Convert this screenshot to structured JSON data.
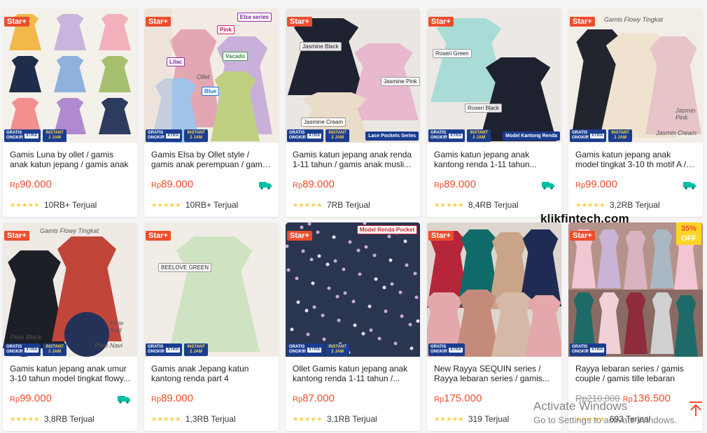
{
  "products": [
    {
      "title": "Gamis Luna by ollet / gamis anak katun jepang / gamis anak",
      "price": "90.000",
      "old_price": "",
      "sold": "10RB+ Terjual",
      "badge": "Star+",
      "free_shipping_icon": false,
      "discount": "",
      "strip_extra": "",
      "stickers": [],
      "art": {
        "bg": "#f4f1ea",
        "swatches": [
          "#f2b94a",
          "#c9b4de",
          "#f2b1bb",
          "#1f2d4a",
          "#8fb1dd",
          "#a6c070",
          "#f28f8f",
          "#b08ad0",
          "#2c3b5e"
        ]
      }
    },
    {
      "title": "Gamis Elsa by Ollet style / gamis anak perempuan / gamis anak",
      "price": "89.000",
      "old_price": "",
      "sold": "10RB+ Terjual",
      "badge": "Star+",
      "free_shipping_icon": true,
      "discount": "",
      "strip_extra": "",
      "stickers": [
        {
          "text": "Elza series",
          "cls": "tag-purple",
          "pos": "right:10px;top:6px;"
        },
        {
          "text": "Pink",
          "cls": "tag-pink",
          "pos": "left:104px;top:24px;"
        },
        {
          "text": "Lilac",
          "cls": "tag-purple",
          "pos": "left:32px;top:70px;"
        },
        {
          "text": "Vacado",
          "cls": "tag-green",
          "pos": "left:112px;top:62px;"
        },
        {
          "text": "Blue",
          "cls": "tag-blue",
          "pos": "left:82px;top:112px;"
        },
        {
          "text": "Ollet",
          "cls": "hand",
          "pos": "left:72px;top:92px;"
        }
      ],
      "art": {
        "bg": "#f2ece4",
        "swatches": [
          "#e3a7b3",
          "#c9b0da",
          "#bfd181",
          "#9fc3e9",
          "#c98da0",
          "#dcd8d0"
        ]
      }
    },
    {
      "title": "Gamis katun jepang anak renda 1-11 tahun / gamis anak musli...",
      "price": "89.000",
      "old_price": "",
      "sold": "7RB Terjual",
      "badge": "Star+",
      "free_shipping_icon": false,
      "discount": "",
      "strip_extra": "Lace Pockets Series",
      "stickers": [
        {
          "text": "Jasmine Black",
          "cls": "",
          "pos": "left:20px;top:48px;"
        },
        {
          "text": "Jasmine Pink",
          "cls": "",
          "pos": "left:136px;top:98px;"
        },
        {
          "text": "Jasmine Cream",
          "cls": "",
          "pos": "left:22px;top:156px;"
        }
      ],
      "art": {
        "bg": "#eae7e2",
        "swatches": [
          "#1f2230",
          "#e8b8cf",
          "#e9dcc9"
        ]
      }
    },
    {
      "title": "Gamis katun jepang anak kantong renda 1-11 tahun...",
      "price": "89.000",
      "old_price": "",
      "sold": "8,4RB Terjual",
      "badge": "Star+",
      "free_shipping_icon": true,
      "discount": "",
      "strip_extra": "Model Kantong Renda",
      "stickers": [
        {
          "text": "Roseri Green",
          "cls": "",
          "pos": "left:8px;top:58px;"
        },
        {
          "text": "Roseri Black",
          "cls": "",
          "pos": "left:54px;top:136px;"
        }
      ],
      "art": {
        "bg": "#ece8e3",
        "swatches": [
          "#a9dcd6",
          "#1e2230"
        ]
      }
    },
    {
      "title": "Gamis katun jepang anak model tingkat 3-10 th motif A / gamis...",
      "price": "99.000",
      "old_price": "",
      "sold": "3,2RB Terjual",
      "badge": "Star+",
      "free_shipping_icon": true,
      "discount": "",
      "strip_extra": "",
      "stickers": [
        {
          "text": "Gamis Flowy Tingkat",
          "cls": "hand",
          "pos": "left:48px;top:10px;"
        },
        {
          "text": "Jasmin Pink",
          "cls": "hand",
          "pos": "left:150px;top:140px;"
        },
        {
          "text": "Jasmin Cream",
          "cls": "hand",
          "pos": "left:122px;top:172px;"
        }
      ],
      "art": {
        "bg": "#f2ede6",
        "swatches": [
          "#22252e",
          "#efe3cf",
          "#e6c4c8"
        ]
      }
    },
    {
      "title": "Gamis katun jepang anak umur 3-10 tahun model tingkat flowy...",
      "price": "99.000",
      "old_price": "",
      "sold": "3,8RB Terjual",
      "badge": "Star+",
      "free_shipping_icon": true,
      "discount": "",
      "strip_extra": "",
      "stickers": [
        {
          "text": "Gamis Flowy Tingkat",
          "cls": "hand",
          "pos": "left:50px;top:6px;"
        },
        {
          "text": "Pixie Red",
          "cls": "hand",
          "pos": "left:150px;top:138px;"
        },
        {
          "text": "Pixie Black",
          "cls": "hand",
          "pos": "left:8px;top:158px;"
        },
        {
          "text": "Pixie Navi",
          "cls": "hand",
          "pos": "left:128px;top:170px;"
        }
      ],
      "art": {
        "bg": "#efeae4",
        "swatches": [
          "#1d1f26",
          "#c2453a",
          "#243257"
        ]
      }
    },
    {
      "title": "Gamis anak Jepang katun kantong renda part 4",
      "price": "89.000",
      "old_price": "",
      "sold": "1,3RB Terjual",
      "badge": "Star+",
      "free_shipping_icon": false,
      "discount": "",
      "strip_extra": "",
      "stickers": [
        {
          "text": "BEELOVE GREEN",
          "cls": "",
          "pos": "left:20px;top:58px;"
        }
      ],
      "art": {
        "bg": "#f1ece6",
        "swatches": [
          "#cfe3c2",
          "#e9e4db"
        ]
      }
    },
    {
      "title": "Ollet Gamis katun jepang anak kantong renda 1-11 tahun /...",
      "price": "87.000",
      "old_price": "",
      "sold": "3,1RB Terjual",
      "badge": "Star+",
      "free_shipping_icon": false,
      "discount": "",
      "strip_extra": "",
      "stickers": [
        {
          "text": "Model Renda Pocket",
          "cls": "brand-red",
          "pos": "right:4px;top:4px;"
        }
      ],
      "art": {
        "bg": "#2a3550",
        "swatches": [
          "#2a3550",
          "#3b4a6e"
        ]
      }
    },
    {
      "title": "New Rayya SEQUIN series / Rayya lebaran series / gamis...",
      "price": "175.000",
      "old_price": "",
      "sold": "319 Terjual",
      "badge": "Star+",
      "free_shipping_icon": false,
      "discount": "",
      "strip_extra": "",
      "stickers": [],
      "art": {
        "bg": "#dcd6cf",
        "swatches": [
          "#b5263a",
          "#0f6b6a",
          "#c9a488",
          "#1f2b52",
          "#e4a8ac",
          "#c58b7a",
          "#d6b8a6"
        ]
      }
    },
    {
      "title": "Rayya lebaran series / gamis couple / gamis tille lebaran",
      "price": "136.500",
      "old_price": "Rp210.000",
      "sold": "693 Terjual",
      "badge": "Star+",
      "free_shipping_icon": false,
      "discount": "35%",
      "strip_extra": "",
      "stickers": [],
      "art": {
        "bg": "#b5938a",
        "swatches": [
          "#f1c6d2",
          "#c9b3d6",
          "#d9b3c0",
          "#aab8c4",
          "#1e6a68",
          "#f2d0d8",
          "#8e2b3c",
          "#d0d0d0"
        ]
      }
    }
  ],
  "labels": {
    "currency": "Rp",
    "stars": "★★★★★",
    "gratis": "GRATIS",
    "ongkir": "ONGKIR",
    "xtra": "XTRA",
    "instant": "INSTANT",
    "two_hours": "2 JAM",
    "off": "OFF"
  },
  "watermark": "klikfintech.com",
  "activate": {
    "line1": "Activate Windows",
    "line2": "Go to Settings to activate Windows."
  },
  "colors": {
    "accent": "#ee4d2d",
    "badge_blue": "#1a3d8f",
    "star": "#ffce3d"
  }
}
